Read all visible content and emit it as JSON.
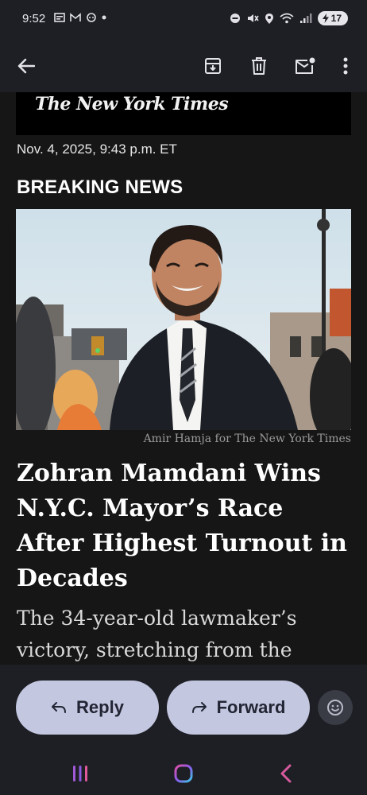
{
  "status_bar": {
    "time": "9:52",
    "battery": "17"
  },
  "email": {
    "masthead": "The New York Times",
    "datetime": "Nov. 4, 2025, 9:43 p.m. ET",
    "label": "BREAKING NEWS",
    "photo_caption": "Amir Hamja for The New York Times",
    "headline": "Zohran Mamdani Wins N.Y.C. Mayor’s Race After Highest Turnout in Decades",
    "summary": "The 34-year-old lawmaker’s victory, stretching from the"
  },
  "actions": {
    "reply_label": "Reply",
    "forward_label": "Forward"
  },
  "icons": {
    "back": "back-arrow-icon",
    "archive": "archive-icon",
    "delete": "trash-icon",
    "unread": "mark-unread-icon",
    "more": "more-vertical-icon",
    "emoji": "emoji-icon"
  },
  "colors": {
    "background": "#1e1f25",
    "pill": "#c3c7e0",
    "content": "#161616"
  }
}
